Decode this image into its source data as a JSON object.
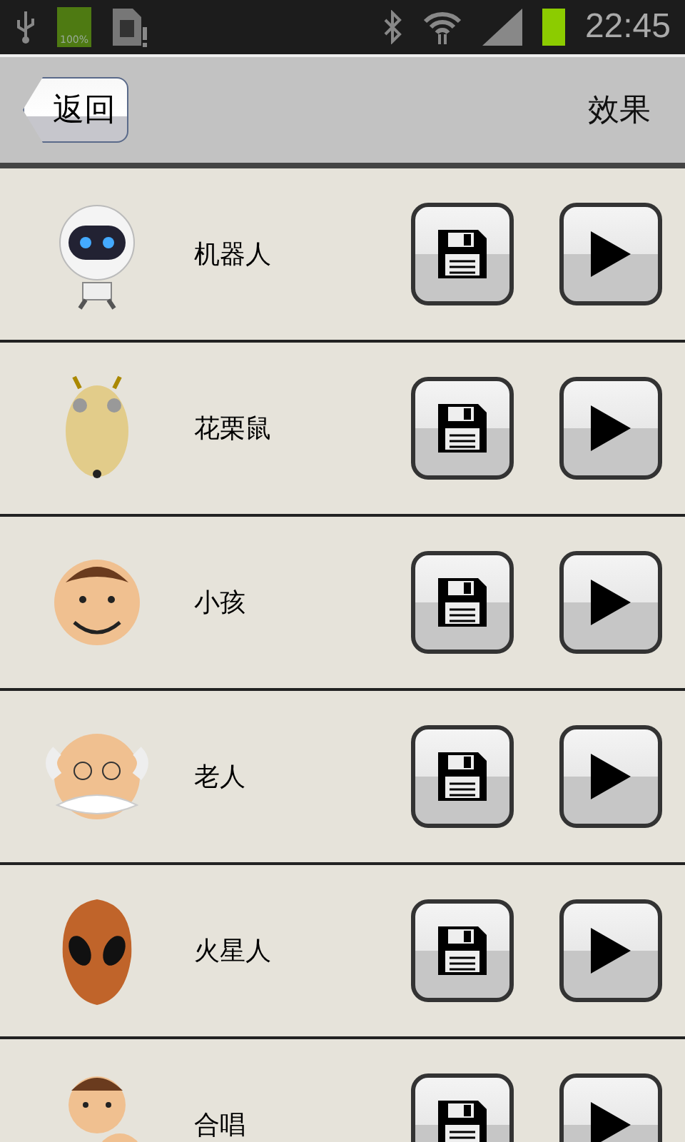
{
  "status_bar": {
    "battery_label": "100%",
    "time": "22:45"
  },
  "header": {
    "back_button": "返回",
    "title": "效果"
  },
  "effects": [
    {
      "name": "机器人"
    },
    {
      "name": "花栗鼠"
    },
    {
      "name": "小孩"
    },
    {
      "name": "老人"
    },
    {
      "name": "火星人"
    },
    {
      "name": "合唱"
    }
  ]
}
